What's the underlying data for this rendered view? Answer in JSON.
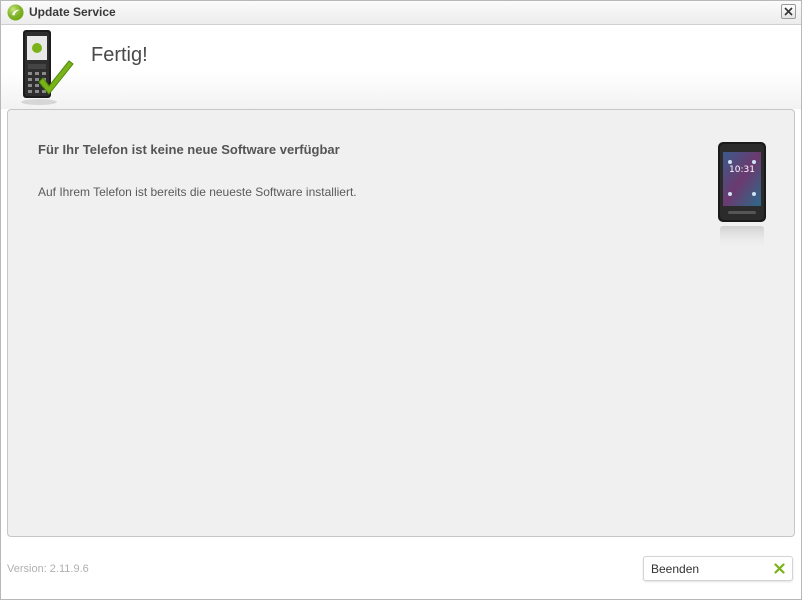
{
  "window": {
    "title": "Update Service",
    "close_label": "close"
  },
  "header": {
    "title": "Fertig!"
  },
  "content": {
    "heading": "Für Ihr Telefon ist keine neue Software verfügbar",
    "message": "Auf Ihrem Telefon ist bereits die neueste Software installiert.",
    "phone_screen_text": "10:31"
  },
  "footer": {
    "version": "Version: 2.11.9.6",
    "finish_label": "Beenden"
  },
  "colors": {
    "accent_green": "#7ab317",
    "content_bg": "#f0f0f0"
  },
  "icons": {
    "app": "sony-ericsson-logo-icon",
    "header": "phone-checkmark-icon",
    "close": "close-icon",
    "finish": "x-icon"
  }
}
